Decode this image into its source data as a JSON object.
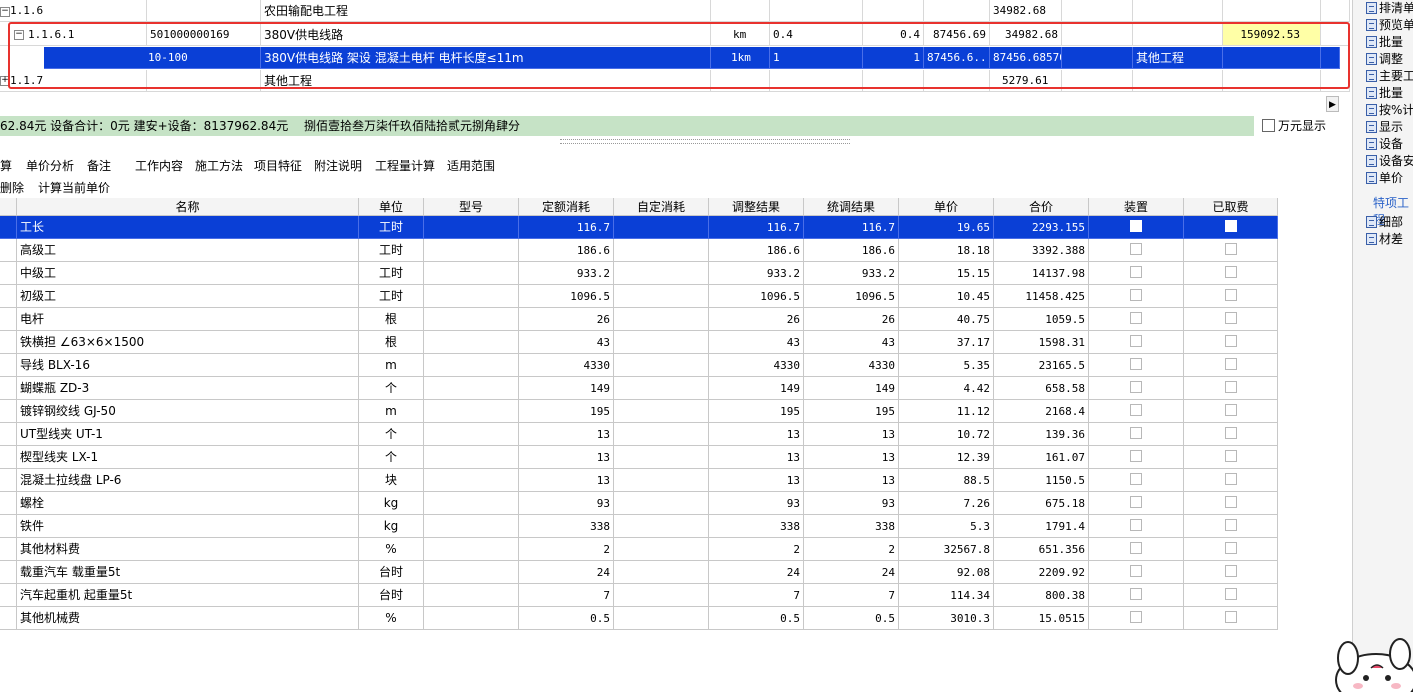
{
  "top_grid": {
    "rows": [
      {
        "code": "1.1.6",
        "number": "",
        "name": "农田输配电工程",
        "unit": "",
        "qty": "",
        "qty2": "",
        "price": "",
        "total": "34982.68",
        "c9": "",
        "c10": "",
        "c11": "",
        "c12": ""
      },
      {
        "code": "1.1.6.1",
        "number": "501000000169",
        "name": "380V供电线路",
        "unit": "km",
        "qty": "0.4",
        "qty2": "0.4",
        "price": "87456.69",
        "total": "34982.68",
        "c9": "",
        "c10": "",
        "c11": "",
        "c12": "159092.53"
      },
      {
        "code": "",
        "number": "10-100",
        "name": "380V供电线路 架设 混凝土电杆 电杆长度≤11m",
        "unit": "1km",
        "qty": "1",
        "qty2": "1",
        "price": "87456.6...",
        "total": "87456.68576",
        "c9": "",
        "c10": "其他工程",
        "c11": "",
        "c12": ""
      },
      {
        "code": "1.1.7",
        "number": "",
        "name": "其他工程",
        "unit": "",
        "qty": "",
        "qty2": "",
        "price": "",
        "total": "5279.61",
        "c9": "",
        "c10": "",
        "c11": "",
        "c12": ""
      }
    ]
  },
  "summary": {
    "part1": "62.84元 设备合计：0元 建安+设备：8137962.84元",
    "part2": "捌佰壹拾叁万柒仟玖佰陆拾贰元捌角肆分",
    "wanyuan_label": "万元显示"
  },
  "tabs": [
    "算",
    "单价分析",
    "备注",
    "工作内容",
    "施工方法",
    "项目特征",
    "附注说明",
    "工程量计算",
    "适用范围"
  ],
  "actions": [
    "删除",
    "计算当前单价"
  ],
  "lower_table": {
    "headers": [
      "名称",
      "单位",
      "型号",
      "定额消耗",
      "自定消耗",
      "调整结果",
      "统调结果",
      "单价",
      "合价",
      "装置",
      "已取费"
    ],
    "rows": [
      {
        "name": "工长",
        "unit": "工时",
        "model": "",
        "quota": "116.7",
        "custom": "",
        "adjusted": "116.7",
        "unified": "116.7",
        "price": "19.65",
        "total": "2293.155"
      },
      {
        "name": "高级工",
        "unit": "工时",
        "model": "",
        "quota": "186.6",
        "custom": "",
        "adjusted": "186.6",
        "unified": "186.6",
        "price": "18.18",
        "total": "3392.388"
      },
      {
        "name": "中级工",
        "unit": "工时",
        "model": "",
        "quota": "933.2",
        "custom": "",
        "adjusted": "933.2",
        "unified": "933.2",
        "price": "15.15",
        "total": "14137.98"
      },
      {
        "name": "初级工",
        "unit": "工时",
        "model": "",
        "quota": "1096.5",
        "custom": "",
        "adjusted": "1096.5",
        "unified": "1096.5",
        "price": "10.45",
        "total": "11458.425"
      },
      {
        "name": "电杆",
        "unit": "根",
        "model": "",
        "quota": "26",
        "custom": "",
        "adjusted": "26",
        "unified": "26",
        "price": "40.75",
        "total": "1059.5"
      },
      {
        "name": "铁横担 ∠63×6×1500",
        "unit": "根",
        "model": "",
        "quota": "43",
        "custom": "",
        "adjusted": "43",
        "unified": "43",
        "price": "37.17",
        "total": "1598.31"
      },
      {
        "name": "导线 BLX-16",
        "unit": "m",
        "model": "",
        "quota": "4330",
        "custom": "",
        "adjusted": "4330",
        "unified": "4330",
        "price": "5.35",
        "total": "23165.5"
      },
      {
        "name": "蝴蝶瓶 ZD-3",
        "unit": "个",
        "model": "",
        "quota": "149",
        "custom": "",
        "adjusted": "149",
        "unified": "149",
        "price": "4.42",
        "total": "658.58"
      },
      {
        "name": "镀锌钢绞线 GJ-50",
        "unit": "m",
        "model": "",
        "quota": "195",
        "custom": "",
        "adjusted": "195",
        "unified": "195",
        "price": "11.12",
        "total": "2168.4"
      },
      {
        "name": "UT型线夹 UT-1",
        "unit": "个",
        "model": "",
        "quota": "13",
        "custom": "",
        "adjusted": "13",
        "unified": "13",
        "price": "10.72",
        "total": "139.36"
      },
      {
        "name": "楔型线夹 LX-1",
        "unit": "个",
        "model": "",
        "quota": "13",
        "custom": "",
        "adjusted": "13",
        "unified": "13",
        "price": "12.39",
        "total": "161.07"
      },
      {
        "name": "混凝土拉线盘 LP-6",
        "unit": "块",
        "model": "",
        "quota": "13",
        "custom": "",
        "adjusted": "13",
        "unified": "13",
        "price": "88.5",
        "total": "1150.5"
      },
      {
        "name": "螺栓",
        "unit": "kg",
        "model": "",
        "quota": "93",
        "custom": "",
        "adjusted": "93",
        "unified": "93",
        "price": "7.26",
        "total": "675.18"
      },
      {
        "name": "铁件",
        "unit": "kg",
        "model": "",
        "quota": "338",
        "custom": "",
        "adjusted": "338",
        "unified": "338",
        "price": "5.3",
        "total": "1791.4"
      },
      {
        "name": "其他材料费",
        "unit": "%",
        "model": "",
        "quota": "2",
        "custom": "",
        "adjusted": "2",
        "unified": "2",
        "price": "32567.8",
        "total": "651.356"
      },
      {
        "name": "载重汽车 载重量5t",
        "unit": "台时",
        "model": "",
        "quota": "24",
        "custom": "",
        "adjusted": "24",
        "unified": "24",
        "price": "92.08",
        "total": "2209.92"
      },
      {
        "name": "汽车起重机 起重量5t",
        "unit": "台时",
        "model": "",
        "quota": "7",
        "custom": "",
        "adjusted": "7",
        "unified": "7",
        "price": "114.34",
        "total": "800.38"
      },
      {
        "name": "其他机械费",
        "unit": "%",
        "model": "",
        "quota": "0.5",
        "custom": "",
        "adjusted": "0.5",
        "unified": "0.5",
        "price": "3010.3",
        "total": "15.0515"
      }
    ]
  },
  "right_panel": {
    "items": [
      "排清单",
      "预览单",
      "批量",
      "调整",
      "主要工",
      "批量",
      "按%计",
      "显示",
      "设备",
      "设备安",
      "单价"
    ],
    "section_title": "特项工程",
    "section_items": [
      "细部",
      "材差"
    ]
  }
}
